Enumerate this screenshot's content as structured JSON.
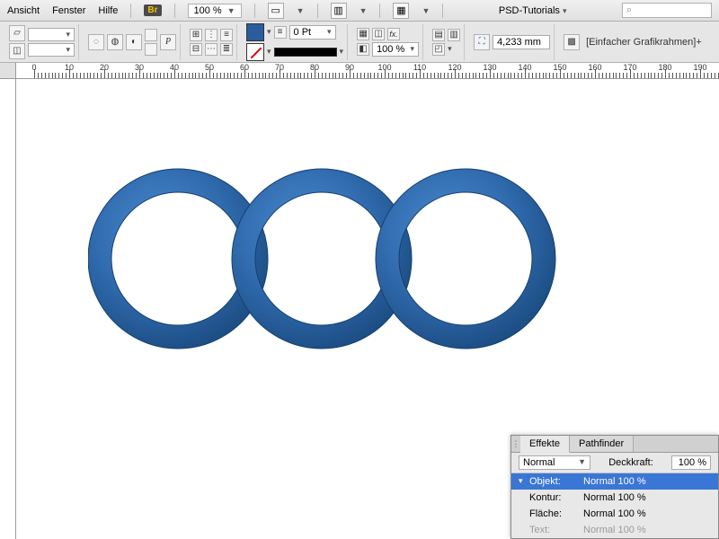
{
  "menu": {
    "ansicht": "Ansicht",
    "fenster": "Fenster",
    "hilfe": "Hilfe",
    "br": "Br",
    "zoom": "100 %",
    "psd": "PSD-Tutorials"
  },
  "opt": {
    "pt": "0 Pt",
    "pct": "100 %",
    "mm": "4,233 mm",
    "frame": "[Einfacher Grafikrahmen]+"
  },
  "ruler": {
    "marks": [
      0,
      10,
      20,
      30,
      40,
      50,
      60,
      70,
      80,
      90,
      100,
      110,
      120,
      130,
      140,
      150,
      160,
      170,
      180,
      190
    ]
  },
  "panel": {
    "tab1": "Effekte",
    "tab2": "Pathfinder",
    "blend": "Normal",
    "opac_label": "Deckkraft:",
    "opac": "100 %",
    "rows": {
      "objekt_k": "Objekt:",
      "objekt_v": "Normal 100 %",
      "kontur_k": "Kontur:",
      "kontur_v": "Normal 100 %",
      "flaeche_k": "Fläche:",
      "flaeche_v": "Normal 100 %",
      "text_k": "Text:",
      "text_v": "Normal 100 %"
    }
  }
}
